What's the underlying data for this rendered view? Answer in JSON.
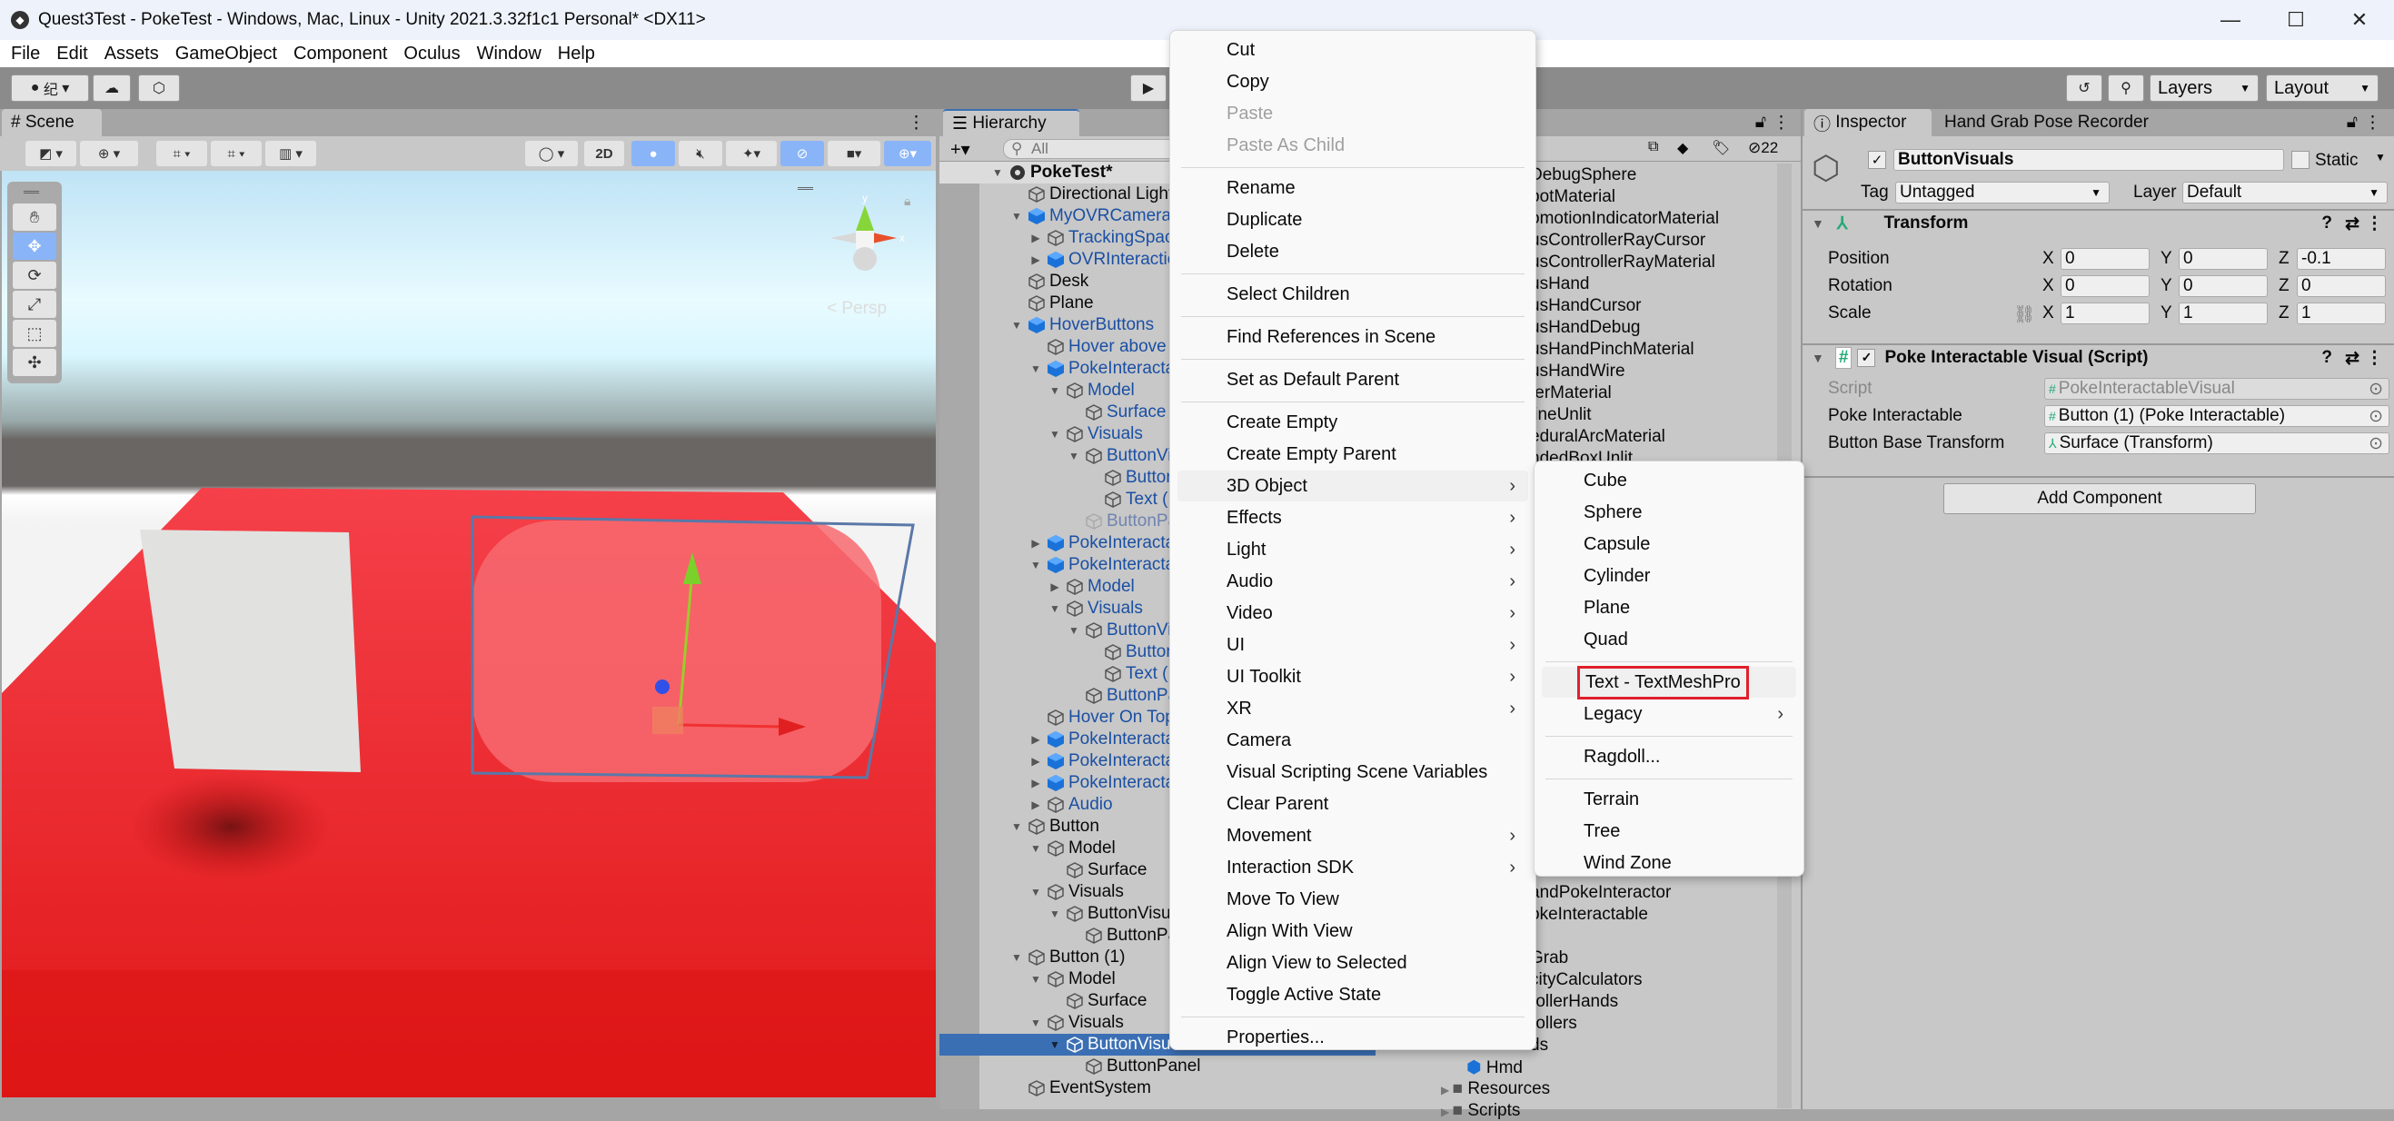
{
  "window": {
    "title": "Quest3Test - PokeTest - Windows, Mac, Linux - Unity 2021.3.32f1c1 Personal* <DX11>",
    "minimize": "—",
    "maximize": "☐",
    "close": "✕"
  },
  "menubar": [
    "File",
    "Edit",
    "Assets",
    "GameObject",
    "Component",
    "Oculus",
    "Window",
    "Help"
  ],
  "toolbar": {
    "account_label": "纪",
    "layers": "Layers",
    "layout": "Layout"
  },
  "scene": {
    "tab": "Scene",
    "btn_2d": "2D",
    "persp_label": "Persp",
    "gizmo_y": "y",
    "gizmo_x": "x"
  },
  "hierarchy": {
    "tab": "Hierarchy",
    "search_placeholder": "All",
    "hidden_count": "22",
    "rows": [
      {
        "label": "PokeTest*",
        "depth": 0,
        "arrow": "down",
        "icon": "scene",
        "style": "bold"
      },
      {
        "label": "Directional Light",
        "depth": 1,
        "arrow": "",
        "icon": "cube",
        "style": "normal"
      },
      {
        "label": "MyOVRCameraRig",
        "depth": 1,
        "arrow": "down",
        "icon": "prefab",
        "style": "blue"
      },
      {
        "label": "TrackingSpace",
        "depth": 2,
        "arrow": "right",
        "icon": "cube",
        "style": "blue"
      },
      {
        "label": "OVRInteraction",
        "depth": 2,
        "arrow": "right",
        "icon": "prefab",
        "style": "blue"
      },
      {
        "label": "Desk",
        "depth": 1,
        "arrow": "",
        "icon": "cube",
        "style": "normal"
      },
      {
        "label": "Plane",
        "depth": 1,
        "arrow": "",
        "icon": "cube",
        "style": "normal"
      },
      {
        "label": "HoverButtons",
        "depth": 1,
        "arrow": "down",
        "icon": "prefab",
        "style": "blue"
      },
      {
        "label": "Hover above",
        "depth": 2,
        "arrow": "",
        "icon": "cube",
        "style": "blue"
      },
      {
        "label": "PokeInteractable",
        "depth": 2,
        "arrow": "down",
        "icon": "prefab",
        "style": "blue"
      },
      {
        "label": "Model",
        "depth": 3,
        "arrow": "down",
        "icon": "cube",
        "style": "blue"
      },
      {
        "label": "Surface",
        "depth": 4,
        "arrow": "",
        "icon": "cube",
        "style": "blue"
      },
      {
        "label": "Visuals",
        "depth": 3,
        "arrow": "down",
        "icon": "cube",
        "style": "blue"
      },
      {
        "label": "ButtonVisuals",
        "depth": 4,
        "arrow": "down",
        "icon": "cube",
        "style": "blue"
      },
      {
        "label": "Button",
        "depth": 5,
        "arrow": "",
        "icon": "cube",
        "style": "blue"
      },
      {
        "label": "Text (",
        "depth": 5,
        "arrow": "",
        "icon": "cube",
        "style": "blue"
      },
      {
        "label": "ButtonPanel",
        "depth": 4,
        "arrow": "",
        "icon": "cube",
        "style": "faded"
      },
      {
        "label": "PokeInteractable",
        "depth": 2,
        "arrow": "right",
        "icon": "prefab",
        "style": "blue"
      },
      {
        "label": "PokeInteractable",
        "depth": 2,
        "arrow": "down",
        "icon": "prefab",
        "style": "blue"
      },
      {
        "label": "Model",
        "depth": 3,
        "arrow": "right",
        "icon": "cube",
        "style": "blue"
      },
      {
        "label": "Visuals",
        "depth": 3,
        "arrow": "down",
        "icon": "cube",
        "style": "blue"
      },
      {
        "label": "ButtonVisuals",
        "depth": 4,
        "arrow": "down",
        "icon": "cube",
        "style": "blue"
      },
      {
        "label": "Button",
        "depth": 5,
        "arrow": "",
        "icon": "cube",
        "style": "blue"
      },
      {
        "label": "Text (",
        "depth": 5,
        "arrow": "",
        "icon": "cube",
        "style": "blue"
      },
      {
        "label": "ButtonPanel",
        "depth": 4,
        "arrow": "",
        "icon": "cube",
        "style": "blue"
      },
      {
        "label": "Hover On Top",
        "depth": 2,
        "arrow": "",
        "icon": "cube",
        "style": "blue"
      },
      {
        "label": "PokeInteractable",
        "depth": 2,
        "arrow": "right",
        "icon": "prefab",
        "style": "blue"
      },
      {
        "label": "PokeInteractable",
        "depth": 2,
        "arrow": "right",
        "icon": "prefab",
        "style": "blue"
      },
      {
        "label": "PokeInteractable",
        "depth": 2,
        "arrow": "right",
        "icon": "prefab",
        "style": "blue"
      },
      {
        "label": "Audio",
        "depth": 2,
        "arrow": "right",
        "icon": "cube",
        "style": "blue"
      },
      {
        "label": "Button",
        "depth": 1,
        "arrow": "down",
        "icon": "cube",
        "style": "normal"
      },
      {
        "label": "Model",
        "depth": 2,
        "arrow": "down",
        "icon": "cube",
        "style": "normal"
      },
      {
        "label": "Surface",
        "depth": 3,
        "arrow": "",
        "icon": "cube",
        "style": "normal"
      },
      {
        "label": "Visuals",
        "depth": 2,
        "arrow": "down",
        "icon": "cube",
        "style": "normal"
      },
      {
        "label": "ButtonVisuals",
        "depth": 3,
        "arrow": "down",
        "icon": "cube",
        "style": "normal"
      },
      {
        "label": "ButtonPanel",
        "depth": 4,
        "arrow": "",
        "icon": "cube",
        "style": "normal"
      },
      {
        "label": "Button (1)",
        "depth": 1,
        "arrow": "down",
        "icon": "cube",
        "style": "normal"
      },
      {
        "label": "Model",
        "depth": 2,
        "arrow": "down",
        "icon": "cube",
        "style": "normal"
      },
      {
        "label": "Surface",
        "depth": 3,
        "arrow": "",
        "icon": "cube",
        "style": "normal"
      },
      {
        "label": "Visuals",
        "depth": 2,
        "arrow": "down",
        "icon": "cube",
        "style": "normal"
      },
      {
        "label": "ButtonVisuals",
        "depth": 3,
        "arrow": "down",
        "icon": "cube",
        "style": "selected"
      },
      {
        "label": "ButtonPanel",
        "depth": 4,
        "arrow": "",
        "icon": "cube",
        "style": "normal"
      },
      {
        "label": "EventSystem",
        "depth": 1,
        "arrow": "",
        "icon": "cube",
        "style": "normal"
      }
    ]
  },
  "project": {
    "items": [
      "DebugSphere",
      "potMaterial",
      "omotionIndicatorMaterial",
      "usControllerRayCursor",
      "usControllerRayMaterial",
      "usHand",
      "usHandCursor",
      "usHandDebug",
      "usHandPinchMaterial",
      "usHandWire",
      "terMaterial",
      "lineUnlit",
      "eduralArcMaterial",
      "ndedBoxUnlit"
    ],
    "lower_items": [
      "andPokeInteractor",
      "okeInteractable",
      "",
      "Grab",
      "cityCalculators",
      "rollerHands",
      "rollers",
      "ds"
    ],
    "hmd": "Hmd",
    "folders": [
      "Resources",
      "Scripts"
    ]
  },
  "inspector": {
    "tab": "Inspector",
    "tab2": "Hand Grab Pose Recorder",
    "object_name": "ButtonVisuals",
    "static_label": "Static",
    "tag_label": "Tag",
    "tag_value": "Untagged",
    "layer_label": "Layer",
    "layer_value": "Default",
    "transform": {
      "title": "Transform",
      "rows": [
        {
          "label": "Position",
          "x": "0",
          "y": "0",
          "z": "-0.1"
        },
        {
          "label": "Rotation",
          "x": "0",
          "y": "0",
          "z": "0"
        },
        {
          "label": "Scale",
          "x": "1",
          "y": "1",
          "z": "1"
        }
      ]
    },
    "script_comp": {
      "title": "Poke Interactable Visual (Script)",
      "rows": [
        {
          "label": "Script",
          "value": "PokeInteractableVisual",
          "disabled": true
        },
        {
          "label": "Poke Interactable",
          "value": "Button (1) (Poke Interactable)",
          "disabled": false
        },
        {
          "label": "Button Base Transform",
          "value": "Surface (Transform)",
          "disabled": false
        }
      ]
    },
    "add_component": "Add Component"
  },
  "context_menu": {
    "items": [
      {
        "label": "Cut",
        "disabled": false,
        "submenu": false
      },
      {
        "label": "Copy",
        "disabled": false,
        "submenu": false
      },
      {
        "label": "Paste",
        "disabled": true,
        "submenu": false
      },
      {
        "label": "Paste As Child",
        "disabled": true,
        "submenu": false
      },
      {
        "sep": true
      },
      {
        "label": "Rename",
        "disabled": false,
        "submenu": false
      },
      {
        "label": "Duplicate",
        "disabled": false,
        "submenu": false
      },
      {
        "label": "Delete",
        "disabled": false,
        "submenu": false
      },
      {
        "sep": true
      },
      {
        "label": "Select Children",
        "disabled": false,
        "submenu": false
      },
      {
        "sep": true
      },
      {
        "label": "Find References in Scene",
        "disabled": false,
        "submenu": false
      },
      {
        "sep": true
      },
      {
        "label": "Set as Default Parent",
        "disabled": false,
        "submenu": false
      },
      {
        "sep": true
      },
      {
        "label": "Create Empty",
        "disabled": false,
        "submenu": false
      },
      {
        "label": "Create Empty Parent",
        "disabled": false,
        "submenu": false
      },
      {
        "label": "3D Object",
        "disabled": false,
        "submenu": true,
        "highlight": true
      },
      {
        "label": "Effects",
        "disabled": false,
        "submenu": true
      },
      {
        "label": "Light",
        "disabled": false,
        "submenu": true
      },
      {
        "label": "Audio",
        "disabled": false,
        "submenu": true
      },
      {
        "label": "Video",
        "disabled": false,
        "submenu": true
      },
      {
        "label": "UI",
        "disabled": false,
        "submenu": true
      },
      {
        "label": "UI Toolkit",
        "disabled": false,
        "submenu": true
      },
      {
        "label": "XR",
        "disabled": false,
        "submenu": true
      },
      {
        "label": "Camera",
        "disabled": false,
        "submenu": false
      },
      {
        "label": "Visual Scripting Scene Variables",
        "disabled": false,
        "submenu": false
      },
      {
        "label": "Clear Parent",
        "disabled": false,
        "submenu": false
      },
      {
        "label": "Movement",
        "disabled": false,
        "submenu": true
      },
      {
        "label": "Interaction SDK",
        "disabled": false,
        "submenu": true
      },
      {
        "label": "Move To View",
        "disabled": false,
        "submenu": false
      },
      {
        "label": "Align With View",
        "disabled": false,
        "submenu": false
      },
      {
        "label": "Align View to Selected",
        "disabled": false,
        "submenu": false
      },
      {
        "label": "Toggle Active State",
        "disabled": false,
        "submenu": false
      },
      {
        "sep": true
      },
      {
        "label": "Properties...",
        "disabled": false,
        "submenu": false
      }
    ],
    "submenu_3d": [
      {
        "label": "Cube"
      },
      {
        "label": "Sphere"
      },
      {
        "label": "Capsule"
      },
      {
        "label": "Cylinder"
      },
      {
        "label": "Plane"
      },
      {
        "label": "Quad"
      },
      {
        "sep": true
      },
      {
        "label": "Text - TextMeshPro",
        "highlight": true,
        "boxed": true
      },
      {
        "label": "Legacy",
        "submenu": true
      },
      {
        "sep": true
      },
      {
        "label": "Ragdoll..."
      },
      {
        "sep": true
      },
      {
        "label": "Terrain"
      },
      {
        "label": "Tree"
      },
      {
        "label": "Wind Zone"
      }
    ]
  },
  "colors": {
    "selection": "#3b6fb4",
    "accent_blue": "#8ab4f8",
    "highlight_box": "#e0202c",
    "scene_red": "#ee2026"
  }
}
